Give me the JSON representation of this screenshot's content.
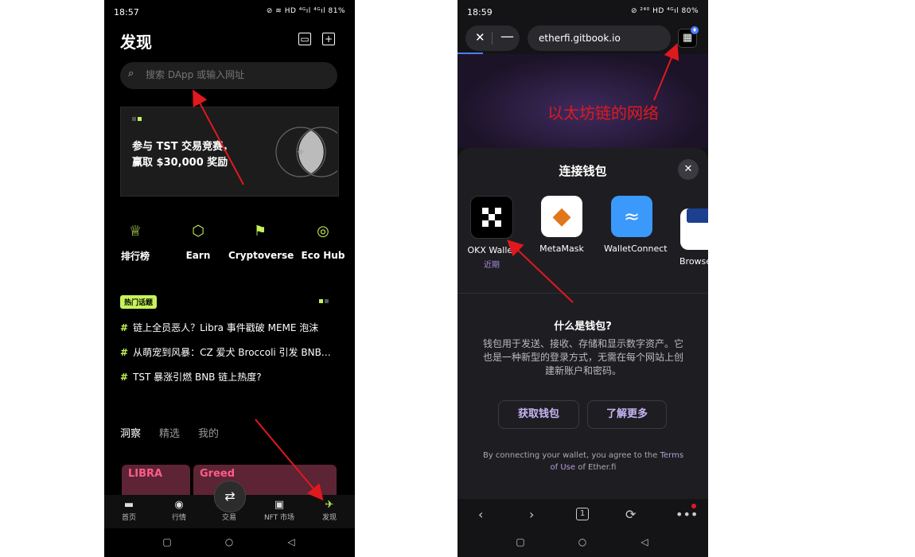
{
  "left": {
    "status": {
      "time": "18:57",
      "battery": "81%",
      "icons": "⊘ ≋ HD ⁴ᴳıl ⁴ᴳıl 81%"
    },
    "header": {
      "title": "发现",
      "calendar_icon": "calendar-icon",
      "add_icon": "plus-square-icon"
    },
    "search": {
      "placeholder": "搜索 DApp 或输入网址"
    },
    "banner": {
      "line1": "参与 TST 交易竞赛，",
      "line2": "赢取 $30,000 奖励"
    },
    "quick": [
      {
        "label": "排行榜",
        "icon": "trophy-icon"
      },
      {
        "label": "Earn",
        "icon": "earn-icon"
      },
      {
        "label": "Cryptoverse",
        "icon": "cryptoverse-icon"
      },
      {
        "label": "Eco Hub",
        "icon": "eco-hub-icon"
      }
    ],
    "hot_badge": "热门话题",
    "topics": [
      "链上全员恶人？Libra 事件戳破 MEME 泡沫",
      "从萌宠到风暴：CZ 爱犬 Broccoli 引发 BNB…",
      "TST 暴涨引燃 BNB 链上热度?"
    ],
    "topic_hash": "#",
    "tabs": [
      "洞察",
      "精选",
      "我的"
    ],
    "cards": [
      "LIBRA",
      "Greed"
    ],
    "bottom_nav": [
      "首页",
      "行情",
      "交易",
      "NFT 市场",
      "发现"
    ]
  },
  "right": {
    "status": {
      "time": "18:59",
      "battery": "80%",
      "icons": "⊘ ²⁴⁰ HD ⁴ᴳıl 80%"
    },
    "url": "etherfi.gitbook.io",
    "annotation": "以太坊链的网络",
    "sheet": {
      "title": "连接钱包",
      "wallets": [
        {
          "name": "OKX Wallet",
          "tag": "近期"
        },
        {
          "name": "MetaMask",
          "tag": ""
        },
        {
          "name": "WalletConnect",
          "tag": ""
        },
        {
          "name": "Browser Wallet",
          "tag": ""
        }
      ],
      "what_title": "什么是钱包?",
      "what_desc": "钱包用于发送、接收、存储和显示数字资产。它也是一种新型的登录方式，无需在每个网站上创建新账户和密码。",
      "get_wallet": "获取钱包",
      "learn_more": "了解更多",
      "legal_prefix": "By connecting your wallet, you agree to the ",
      "legal_link": "Terms of Use",
      "legal_suffix": " of Ether.fi"
    },
    "browser_bar": {
      "tabs_count": "1"
    }
  },
  "colors": {
    "accent_green": "#c6f35a",
    "purple_link": "#b39ddb",
    "arrow_red": "#e0191e"
  }
}
